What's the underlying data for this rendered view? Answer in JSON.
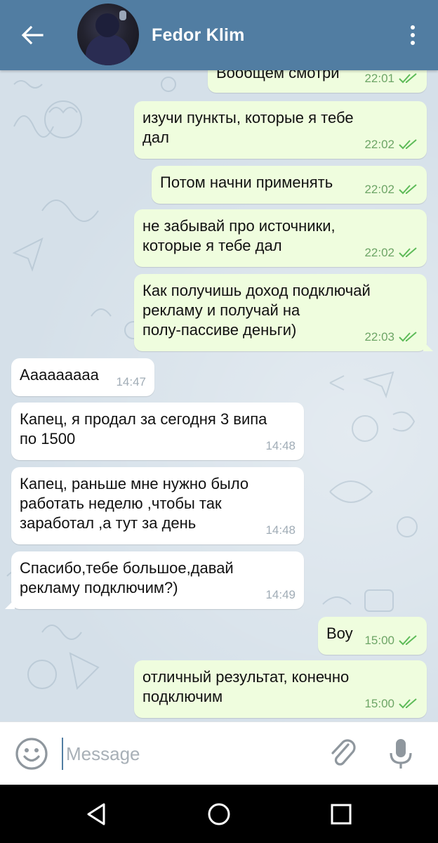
{
  "header": {
    "contact_name": "Fedor Klim",
    "color": "#517da2"
  },
  "messages": [
    {
      "direction": "out",
      "text": "Вообщем смотри",
      "time": "22:01",
      "read": true
    },
    {
      "direction": "out",
      "text": "изучи пункты, которые я тебе\nдал",
      "time": "22:02",
      "read": true
    },
    {
      "direction": "out",
      "text": "Потом начни применять",
      "time": "22:02",
      "read": true
    },
    {
      "direction": "out",
      "text": "не забывай про источники,\nкоторые я тебе дал",
      "time": "22:02",
      "read": true
    },
    {
      "direction": "out",
      "text": "Как получишь доход подключай\nрекламу и получай на\nполу-пассиве деньги)",
      "time": "22:03",
      "read": true
    },
    {
      "direction": "in",
      "text": "Аааааaааа",
      "time": "14:47"
    },
    {
      "direction": "in",
      "text": "Капец, я продал за сегодня 3 випа\nпо 1500",
      "time": "14:48"
    },
    {
      "direction": "in",
      "text": "Капец, раньше мне нужно было\nработать неделю ,чтобы так\nзаработал ,а тут за день",
      "time": "14:48"
    },
    {
      "direction": "in",
      "text": "Спасибо,тебе большое,давай\nрекламу подключим?)",
      "time": "14:49"
    },
    {
      "direction": "out",
      "text": "Воу",
      "time": "15:00",
      "read": true
    },
    {
      "direction": "out",
      "text": "отличный результат, конечно\nподключим",
      "time": "15:00",
      "read": true
    }
  ],
  "input": {
    "placeholder": "Message",
    "value": ""
  },
  "icons": {
    "back": "arrow-back-icon",
    "menu": "more-vertical-icon",
    "emoji": "emoji-icon",
    "attach": "paperclip-icon",
    "mic": "microphone-icon",
    "read": "double-check-icon"
  },
  "colors": {
    "outgoing_bubble": "#effdde",
    "incoming_bubble": "#ffffff",
    "outgoing_time": "#6da566",
    "incoming_time": "#a0acb6",
    "check": "#5dbb58"
  }
}
